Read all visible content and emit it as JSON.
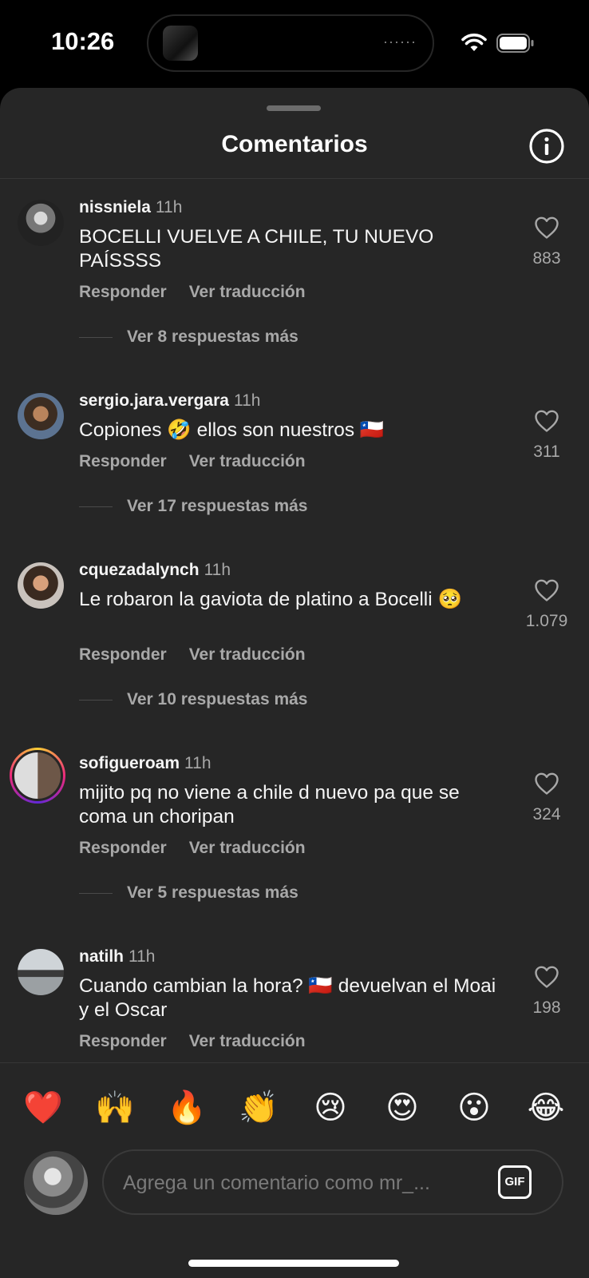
{
  "status_bar": {
    "time": "10:26",
    "island_dots": "······"
  },
  "sheet": {
    "title": "Comentarios"
  },
  "comments": [
    {
      "username": "nissniela",
      "time": "11h",
      "text": "BOCELLI VUELVE A CHILE, TU NUEVO PAÍSSSS",
      "likes": "883",
      "reply_label": "Responder",
      "translate_label": "Ver traducción",
      "replies_label": "Ver 8 respuestas más"
    },
    {
      "username": "sergio.jara.vergara",
      "time": "11h",
      "text": "Copiones 🤣 ellos son nuestros 🇨🇱",
      "likes": "311",
      "reply_label": "Responder",
      "translate_label": "Ver traducción",
      "replies_label": "Ver 17 respuestas más"
    },
    {
      "username": "cquezadalynch",
      "time": "11h",
      "text": "Le robaron la gaviota de platino a Bocelli 🥺",
      "likes": "1.079",
      "reply_label": "Responder",
      "translate_label": "Ver traducción",
      "replies_label": "Ver 10 respuestas más"
    },
    {
      "username": "sofigueroam",
      "time": "11h",
      "text": "mijito pq no viene a chile d nuevo pa que se coma un choripan",
      "likes": "324",
      "reply_label": "Responder",
      "translate_label": "Ver traducción",
      "replies_label": "Ver 5 respuestas más"
    },
    {
      "username": "natilh",
      "time": "11h",
      "text": "Cuando cambian la hora? 🇨🇱 devuelvan el Moai y el Oscar",
      "likes": "198",
      "reply_label": "Responder",
      "translate_label": "Ver traducción"
    }
  ],
  "emoji_bar": [
    "❤️",
    "🙌",
    "🔥",
    "👏",
    "😢",
    "😍",
    "😮",
    "😂"
  ],
  "composer": {
    "placeholder": "Agrega un comentario como mr_...",
    "gif_label": "GIF"
  },
  "icons": {
    "info": "info-icon",
    "like": "heart-icon",
    "wifi": "wifi-icon",
    "battery": "battery-icon"
  },
  "colors": {
    "sheet_background": "#262626",
    "secondary_text": "#a8a8a8",
    "primary_text": "#f5f5f5"
  }
}
